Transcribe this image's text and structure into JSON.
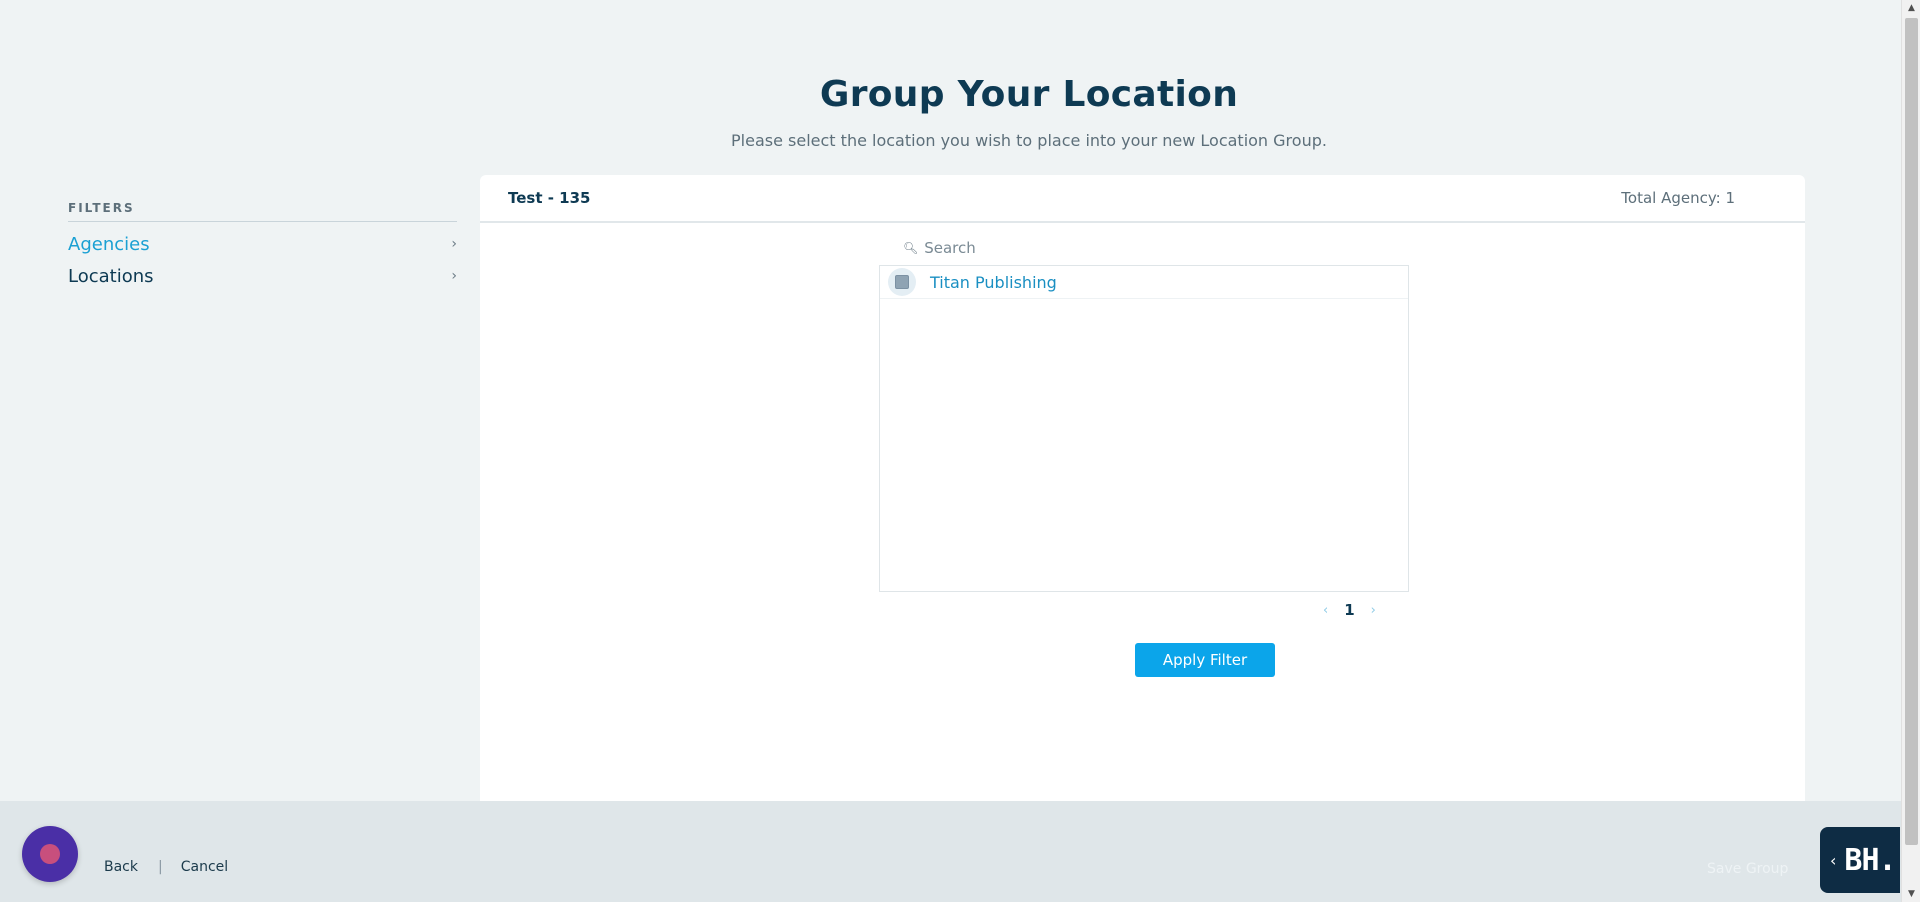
{
  "header": {
    "title": "Group Your Location",
    "subtitle": "Please select the location you wish to place into your new Location Group."
  },
  "filters": {
    "heading": "FILTERS",
    "items": [
      {
        "label": "Agencies",
        "active": true
      },
      {
        "label": "Locations",
        "active": false
      }
    ]
  },
  "card": {
    "title": "Test - 135",
    "total": "Total Agency: 1",
    "search": {
      "placeholder": "Search",
      "value": ""
    },
    "list": [
      {
        "label": "Titan Publishing",
        "checked": false
      }
    ],
    "pager": {
      "current": "1",
      "prev_icon": "chevron-left-icon",
      "next_icon": "chevron-right-icon"
    },
    "apply_label": "Apply Filter"
  },
  "footer": {
    "back_label": "Back",
    "separator": "|",
    "cancel_label": "Cancel",
    "save_label": "Save Group",
    "brand_logo": "BH."
  },
  "colors": {
    "accent": "#0ba5ea",
    "title": "#0e3a53",
    "link": "#1aa0d3",
    "bot_bubble": "#4a2fa6",
    "brand_tab": "#0e2c44"
  }
}
